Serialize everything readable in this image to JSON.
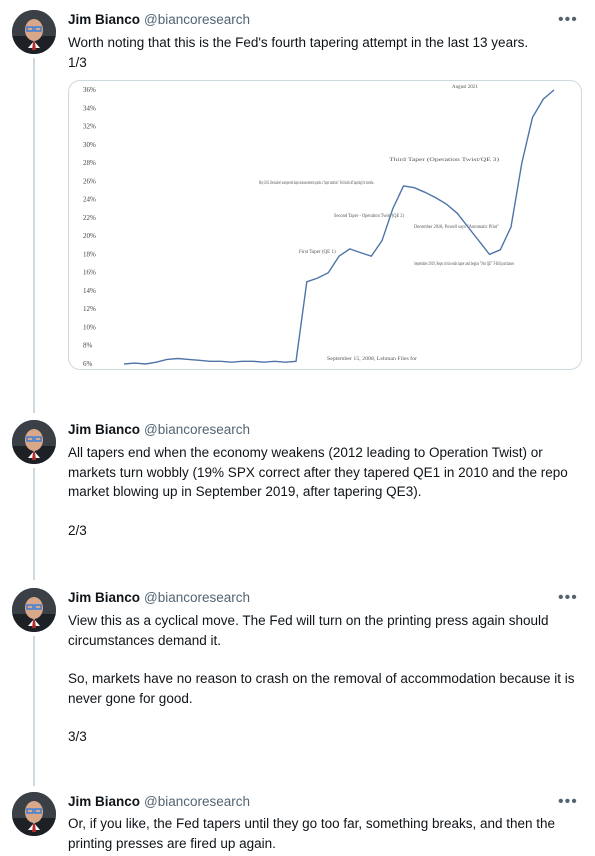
{
  "tweets": [
    {
      "name": "Jim Bianco",
      "handle": "@biancoresearch",
      "text": "Worth noting that this is the Fed's fourth tapering attempt in the last 13 years.",
      "count": "1/3"
    },
    {
      "name": "Jim Bianco",
      "handle": "@biancoresearch",
      "text": "All tapers end when the economy weakens (2012 leading to Operation Twist) or markets turn wobbly (19% SPX correct after they tapered QE1 in 2010 and the repo market blowing up in September 2019, after tapering QE3).",
      "count": "2/3"
    },
    {
      "name": "Jim Bianco",
      "handle": "@biancoresearch",
      "text": "View this as a cyclical move.  The Fed will turn on the printing press again should circumstances demand it.",
      "text2": "So, markets have no reason to crash on the removal of accommodation because it is never gone for good.",
      "count": "3/3"
    },
    {
      "name": "Jim Bianco",
      "handle": "@biancoresearch",
      "text": "Or, if you like, the Fed tapers until they go too far, something breaks, and then the printing presses are fired up again."
    }
  ],
  "more_icon": "more-horizontal-icon",
  "chart_data": {
    "type": "line",
    "title": "",
    "ylim": [
      6,
      36
    ],
    "yticks": [
      "6%",
      "8%",
      "10%",
      "12%",
      "14%",
      "16%",
      "18%",
      "20%",
      "22%",
      "24%",
      "26%",
      "28%",
      "30%",
      "32%",
      "34%",
      "36%"
    ],
    "series": [
      {
        "values": [
          6.0,
          6.1,
          6.0,
          6.2,
          6.5,
          6.6,
          6.5,
          6.4,
          6.3,
          6.3,
          6.2,
          6.3,
          6.3,
          6.2,
          6.3,
          6.2,
          6.3,
          15.0,
          15.4,
          16.0,
          17.8,
          18.6,
          18.2,
          17.8,
          19.5,
          23.0,
          25.5,
          25.3,
          24.8,
          24.2,
          23.5,
          22.5,
          21.0,
          19.5,
          18.0,
          18.5,
          21.0,
          28.0,
          33.0,
          35.0,
          36.0
        ]
      }
    ],
    "annotations": [
      "August 2021",
      "Third Taper (Operation Twist/QE 3)",
      "May 2013, Bernanke's unexpected taper announcement sparks a \"taper tantrum.\" Fed holds off tapering for months.",
      "Second Taper - Operation Twist (QE 2)",
      "December 2018, Powell says \"Automatic Pilot\"",
      "First Taper (QE 1)",
      "September 2019, Repo crisis ends taper and begins \"Not QE\" T-Bill purchases",
      "September 15, 2008, Lehman Files for"
    ]
  }
}
